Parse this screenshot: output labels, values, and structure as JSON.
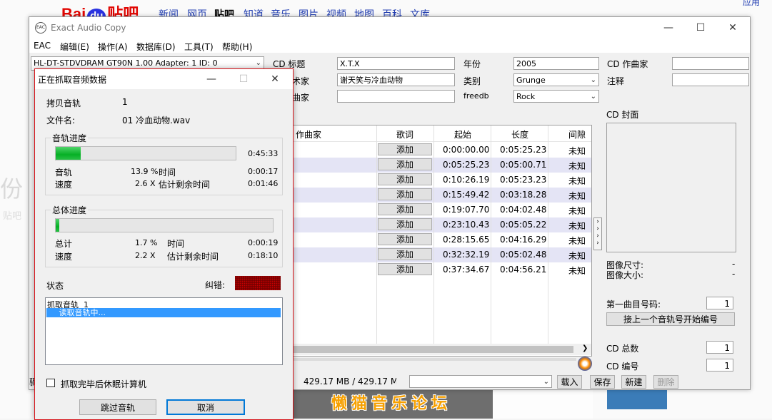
{
  "background": {
    "logo": {
      "left": "Bai",
      "mid": "du",
      "right": "贴吧"
    },
    "nav": [
      "新闻",
      "网页",
      "贴吧",
      "知道",
      "音乐",
      "图片",
      "视频",
      "地图",
      "百科",
      "文库"
    ],
    "left_text": "份",
    "left_sub": "贴吧",
    "forum_banner": "懒猫音乐论坛",
    "topright_text": "应用"
  },
  "eac": {
    "title": "Exact Audio Copy",
    "app_icon": "EAC",
    "menu": [
      "EAC",
      "编辑(E)",
      "操作(A)",
      "数据库(D)",
      "工具(T)",
      "帮助(H)"
    ],
    "drive": "HL-DT-STDVDRAM GT90N 1.00   Adapter: 1  ID: 0",
    "metadata": {
      "cd_title_label": "CD 标题",
      "cd_title": "X.T.X",
      "artist_label": "艺术家",
      "artist": "谢天笑与冷血动物",
      "composer_label": "作曲家",
      "composer": "",
      "year_label": "年份",
      "year": "2005",
      "genre_label": "类别",
      "genre": "Grunge",
      "freedb_label": "freedb",
      "freedb": "Rock",
      "cd_composer_label": "CD 作曲家",
      "cd_composer": "",
      "comment_label": "注释",
      "comment": ""
    },
    "columns": {
      "composer": "作曲家",
      "lyrics": "歌词",
      "start": "起始",
      "length": "长度",
      "gap": "间隙"
    },
    "add_label": "添加",
    "tracks": [
      {
        "start": "0:00:00.00",
        "length": "0:05:25.23",
        "gap": "未知"
      },
      {
        "start": "0:05:25.23",
        "length": "0:05:00.71",
        "gap": "未知"
      },
      {
        "start": "0:10:26.19",
        "length": "0:05:23.23",
        "gap": "未知"
      },
      {
        "start": "0:15:49.42",
        "length": "0:03:18.28",
        "gap": "未知"
      },
      {
        "start": "0:19:07.70",
        "length": "0:04:02.48",
        "gap": "未知"
      },
      {
        "start": "0:23:10.43",
        "length": "0:05:05.22",
        "gap": "未知"
      },
      {
        "start": "0:28:15.65",
        "length": "0:04:16.29",
        "gap": "未知"
      },
      {
        "start": "0:32:32.19",
        "length": "0:05:02.48",
        "gap": "未知"
      },
      {
        "start": "0:37:34.67",
        "length": "0:04:56.21",
        "gap": "未知"
      }
    ],
    "cover": {
      "label": "CD 封面",
      "img_size_label": "图像尺寸:",
      "img_size": "-",
      "img_bytes_label": "图像大小:",
      "img_bytes": "-"
    },
    "first_track_label": "第一曲目号码:",
    "first_track": "1",
    "continue_numbering": "接上一个音轨号开始编号",
    "cd_total_label": "CD 总数",
    "cd_total": "1",
    "cd_number_label": "CD 编号",
    "cd_number": "1",
    "status_size": "429.17 MB / 429.17 MB",
    "status_left": "骤",
    "buttons": {
      "load": "载入",
      "save": "保存",
      "new": "新建",
      "delete": "删除"
    }
  },
  "rip": {
    "title": "正在抓取音频数据",
    "copy_track_label": "拷贝音轨",
    "copy_track": "1",
    "filename_label": "文件名:",
    "filename": "01 冷血动物.wav",
    "track_progress": {
      "title": "音轨进度",
      "fill": 0.139,
      "total_time": "0:45:33",
      "track_label": "音轨",
      "track_percent": "13.9 %",
      "time_label": "时间",
      "time": "0:00:17",
      "speed_label": "速度",
      "speed": "2.6 X",
      "remaining_label": "估计剩余时间",
      "remaining": "0:01:46"
    },
    "overall_progress": {
      "title": "总体进度",
      "fill": 0.017,
      "total_label": "总计",
      "total_percent": "1.7 %",
      "time_label": "时间",
      "time": "0:00:19",
      "speed_label": "速度",
      "speed": "2.2 X",
      "remaining_label": "估计剩余时间",
      "remaining": "0:18:10"
    },
    "status_label": "状态",
    "error_label": "纠错:",
    "status_lines": [
      "抓取音轨  1",
      "     读取音轨中..."
    ],
    "shutdown_label": "抓取完毕后休眠计算机",
    "skip_button": "跳过音轨",
    "cancel_button": "取消"
  }
}
